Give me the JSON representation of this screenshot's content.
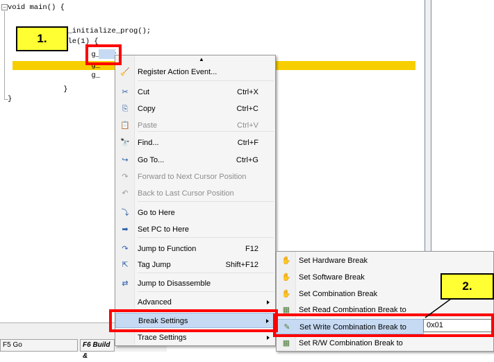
{
  "editor": {
    "lines": [
      "void main() {",
      "",
      "    i_initialize_prog();",
      "    ile(1) {",
      "        g_i++;",
      "        g_",
      "        g_",
      "    }",
      "}"
    ],
    "fold_symbol": "−",
    "selected_token": "g_i"
  },
  "callouts": {
    "step1": "1.",
    "step2": "2."
  },
  "context_menu": {
    "top_arrow": "▲",
    "items": [
      {
        "icon": "broom-icon",
        "glyph": "🧹",
        "label": "Register Action Event...",
        "shortcut": "",
        "disabled": false
      },
      {
        "icon": "scissors-icon",
        "glyph": "✂",
        "label": "Cut",
        "shortcut": "Ctrl+X",
        "disabled": false
      },
      {
        "icon": "copy-icon",
        "glyph": "⎘",
        "label": "Copy",
        "shortcut": "Ctrl+C",
        "disabled": false
      },
      {
        "icon": "paste-icon",
        "glyph": "📋",
        "label": "Paste",
        "shortcut": "Ctrl+V",
        "disabled": true
      },
      {
        "icon": "binoculars-icon",
        "glyph": "🔭",
        "label": "Find...",
        "shortcut": "Ctrl+F",
        "disabled": false
      },
      {
        "icon": "goto-icon",
        "glyph": "↪",
        "label": "Go To...",
        "shortcut": "Ctrl+G",
        "disabled": false
      },
      {
        "icon": "forward-icon",
        "glyph": "↷",
        "label": "Forward to Next Cursor Position",
        "shortcut": "",
        "disabled": true
      },
      {
        "icon": "back-icon",
        "glyph": "↶",
        "label": "Back to Last Cursor Position",
        "shortcut": "",
        "disabled": true
      },
      {
        "icon": "go-here-icon",
        "glyph": "⤵",
        "label": "Go to Here",
        "shortcut": "",
        "disabled": false
      },
      {
        "icon": "set-pc-icon",
        "glyph": "➡",
        "label": "Set PC to Here",
        "shortcut": "",
        "disabled": false
      },
      {
        "icon": "jump-function-icon",
        "glyph": "↷",
        "label": "Jump to Function",
        "shortcut": "F12",
        "disabled": false
      },
      {
        "icon": "tag-jump-icon",
        "glyph": "⇱",
        "label": "Tag Jump",
        "shortcut": "Shift+F12",
        "disabled": false
      },
      {
        "icon": "disassemble-icon",
        "glyph": "⇄",
        "label": "Jump to Disassemble",
        "shortcut": "",
        "disabled": false
      },
      {
        "icon": "",
        "glyph": "",
        "label": "Advanced",
        "shortcut": "",
        "disabled": false,
        "submenu": true
      },
      {
        "icon": "",
        "glyph": "",
        "label": "Break Settings",
        "shortcut": "",
        "disabled": false,
        "submenu": true,
        "selected": true
      },
      {
        "icon": "",
        "glyph": "",
        "label": "Trace Settings",
        "shortcut": "",
        "disabled": false,
        "submenu": true
      }
    ]
  },
  "submenu": {
    "items": [
      {
        "icon": "hardware-break-icon",
        "glyph": "✋",
        "label": "Set Hardware Break"
      },
      {
        "icon": "software-break-icon",
        "glyph": "✋",
        "label": "Set Software Break"
      },
      {
        "icon": "combination-break-icon",
        "glyph": "✋",
        "label": "Set Combination Break"
      },
      {
        "icon": "read-combination-icon",
        "glyph": "▦",
        "label": "Set Read Combination Break to"
      },
      {
        "icon": "write-combination-icon",
        "glyph": "✎",
        "label": "Set Write Combination Break to",
        "selected": true
      },
      {
        "icon": "rw-combination-icon",
        "glyph": "▦",
        "label": "Set R/W Combination Break to"
      }
    ],
    "value_input": "0x01"
  },
  "statusbar": {
    "cell1": "F5 Go",
    "cell2": "F6 Build &"
  },
  "colors": {
    "highlight_line": "#f7ce00",
    "callout": "#ffff33",
    "red_box": "#ff0000",
    "menu_selected": "#c7daf3"
  }
}
